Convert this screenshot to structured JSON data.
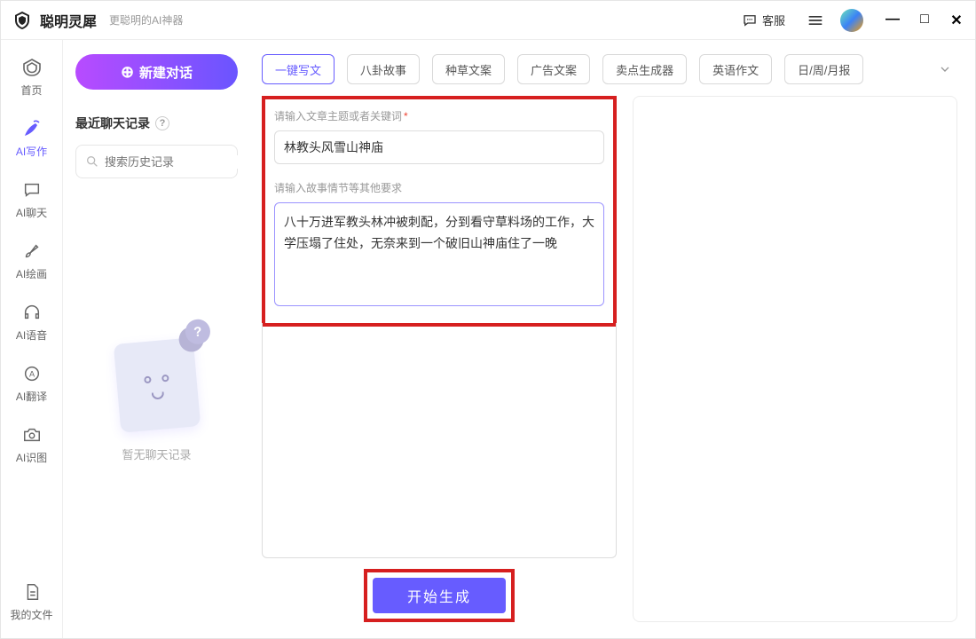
{
  "app": {
    "name": "聪明灵犀",
    "subtitle": "更聪明的AI神器"
  },
  "titlebar": {
    "support_label": "客服",
    "ctrls": {
      "min": "—",
      "max": "□",
      "close": "✕"
    }
  },
  "rail": {
    "items": [
      {
        "label": "首页",
        "icon": "home"
      },
      {
        "label": "AI写作",
        "icon": "pen"
      },
      {
        "label": "AI聊天",
        "icon": "chat"
      },
      {
        "label": "AI绘画",
        "icon": "brush"
      },
      {
        "label": "AI语音",
        "icon": "audio"
      },
      {
        "label": "AI翻译",
        "icon": "translate"
      },
      {
        "label": "AI识图",
        "icon": "vision"
      }
    ],
    "bottom": {
      "label": "我的文件",
      "icon": "file"
    },
    "active_index": 1
  },
  "history_col": {
    "new_chat_label": "新建对话",
    "title": "最近聊天记录",
    "search_placeholder": "搜索历史记录",
    "empty_text": "暂无聊天记录"
  },
  "chips": {
    "items": [
      "一键写文",
      "八卦故事",
      "种草文案",
      "广告文案",
      "卖点生成器",
      "英语作文",
      "日/周/月报"
    ],
    "selected_index": 0
  },
  "form": {
    "topic_label": "请输入文章主题或者关键词",
    "topic_value": "林教头风雪山神庙",
    "story_label": "请输入故事情节等其他要求",
    "story_value": "八十万进军教头林冲被刺配，分到看守草料场的工作，大学压塌了住处，无奈来到一个破旧山神庙住了一晚",
    "generate_label": "开始生成"
  }
}
